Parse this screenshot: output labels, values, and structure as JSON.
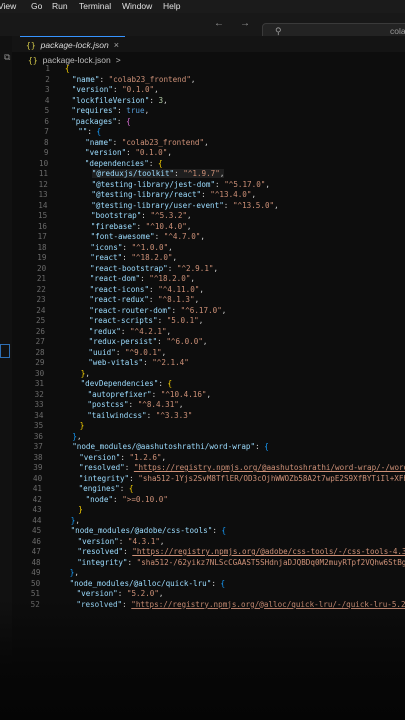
{
  "menu": [
    "View",
    "Go",
    "Run",
    "Terminal",
    "Window",
    "Help"
  ],
  "search": {
    "text": "colab"
  },
  "tab": {
    "braces": "{}",
    "label": "package-lock.json",
    "close": "×"
  },
  "breadcrumb": {
    "braces": "{}",
    "label": "package-lock.json",
    "chevron": ">"
  },
  "nav": {
    "back": "←",
    "forward": "→"
  },
  "lines": [
    {
      "n": 1,
      "i": 0,
      "t": [
        [
          "br1",
          "{"
        ]
      ]
    },
    {
      "n": 2,
      "i": 1,
      "t": [
        [
          "k",
          "\"name\""
        ],
        [
          "p",
          ": "
        ],
        [
          "s",
          "\"colab23_frontend\""
        ],
        [
          "p",
          ","
        ]
      ]
    },
    {
      "n": 3,
      "i": 1,
      "t": [
        [
          "k",
          "\"version\""
        ],
        [
          "p",
          ": "
        ],
        [
          "s",
          "\"0.1.0\""
        ],
        [
          "p",
          ","
        ]
      ]
    },
    {
      "n": 4,
      "i": 1,
      "t": [
        [
          "k",
          "\"lockfileVersion\""
        ],
        [
          "p",
          ": "
        ],
        [
          "n",
          "3"
        ],
        [
          "p",
          ","
        ]
      ]
    },
    {
      "n": 5,
      "i": 1,
      "t": [
        [
          "k",
          "\"requires\""
        ],
        [
          "p",
          ": "
        ],
        [
          "b",
          "true"
        ],
        [
          "p",
          ","
        ]
      ]
    },
    {
      "n": 6,
      "i": 1,
      "t": [
        [
          "k",
          "\"packages\""
        ],
        [
          "p",
          ": "
        ],
        [
          "br2",
          "{"
        ]
      ]
    },
    {
      "n": 7,
      "i": 2,
      "t": [
        [
          "k",
          "\"\""
        ],
        [
          "p",
          ": "
        ],
        [
          "br3",
          "{"
        ]
      ]
    },
    {
      "n": 8,
      "i": 3,
      "t": [
        [
          "k",
          "\"name\""
        ],
        [
          "p",
          ": "
        ],
        [
          "s",
          "\"colab23_frontend\""
        ],
        [
          "p",
          ","
        ]
      ]
    },
    {
      "n": 9,
      "i": 3,
      "t": [
        [
          "k",
          "\"version\""
        ],
        [
          "p",
          ": "
        ],
        [
          "s",
          "\"0.1.0\""
        ],
        [
          "p",
          ","
        ]
      ]
    },
    {
      "n": 10,
      "i": 3,
      "t": [
        [
          "k",
          "\"dependencies\""
        ],
        [
          "p",
          ": "
        ],
        [
          "br1",
          "{"
        ]
      ]
    },
    {
      "n": 11,
      "i": 4,
      "t": [
        [
          "k",
          "\"@reduxjs/toolkit\""
        ],
        [
          "p",
          ": "
        ],
        [
          "s",
          "\"^1.9.7\""
        ],
        [
          "p",
          ","
        ]
      ],
      "hl": true
    },
    {
      "n": 12,
      "i": 4,
      "t": [
        [
          "k",
          "\"@testing-library/jest-dom\""
        ],
        [
          "p",
          ": "
        ],
        [
          "s",
          "\"^5.17.0\""
        ],
        [
          "p",
          ","
        ]
      ]
    },
    {
      "n": 13,
      "i": 4,
      "t": [
        [
          "k",
          "\"@testing-library/react\""
        ],
        [
          "p",
          ": "
        ],
        [
          "s",
          "\"^13.4.0\""
        ],
        [
          "p",
          ","
        ]
      ]
    },
    {
      "n": 14,
      "i": 4,
      "t": [
        [
          "k",
          "\"@testing-library/user-event\""
        ],
        [
          "p",
          ": "
        ],
        [
          "s",
          "\"^13.5.0\""
        ],
        [
          "p",
          ","
        ]
      ]
    },
    {
      "n": 15,
      "i": 4,
      "t": [
        [
          "k",
          "\"bootstrap\""
        ],
        [
          "p",
          ": "
        ],
        [
          "s",
          "\"^5.3.2\""
        ],
        [
          "p",
          ","
        ]
      ]
    },
    {
      "n": 16,
      "i": 4,
      "t": [
        [
          "k",
          "\"firebase\""
        ],
        [
          "p",
          ": "
        ],
        [
          "s",
          "\"^10.4.0\""
        ],
        [
          "p",
          ","
        ]
      ]
    },
    {
      "n": 17,
      "i": 4,
      "t": [
        [
          "k",
          "\"font-awesome\""
        ],
        [
          "p",
          ": "
        ],
        [
          "s",
          "\"^4.7.0\""
        ],
        [
          "p",
          ","
        ]
      ]
    },
    {
      "n": 18,
      "i": 4,
      "t": [
        [
          "k",
          "\"icons\""
        ],
        [
          "p",
          ": "
        ],
        [
          "s",
          "\"^1.0.0\""
        ],
        [
          "p",
          ","
        ]
      ]
    },
    {
      "n": 19,
      "i": 4,
      "t": [
        [
          "k",
          "\"react\""
        ],
        [
          "p",
          ": "
        ],
        [
          "s",
          "\"^18.2.0\""
        ],
        [
          "p",
          ","
        ]
      ]
    },
    {
      "n": 20,
      "i": 4,
      "t": [
        [
          "k",
          "\"react-bootstrap\""
        ],
        [
          "p",
          ": "
        ],
        [
          "s",
          "\"^2.9.1\""
        ],
        [
          "p",
          ","
        ]
      ]
    },
    {
      "n": 21,
      "i": 4,
      "t": [
        [
          "k",
          "\"react-dom\""
        ],
        [
          "p",
          ": "
        ],
        [
          "s",
          "\"^18.2.0\""
        ],
        [
          "p",
          ","
        ]
      ]
    },
    {
      "n": 22,
      "i": 4,
      "t": [
        [
          "k",
          "\"react-icons\""
        ],
        [
          "p",
          ": "
        ],
        [
          "s",
          "\"^4.11.0\""
        ],
        [
          "p",
          ","
        ]
      ]
    },
    {
      "n": 23,
      "i": 4,
      "t": [
        [
          "k",
          "\"react-redux\""
        ],
        [
          "p",
          ": "
        ],
        [
          "s",
          "\"^8.1.3\""
        ],
        [
          "p",
          ","
        ]
      ]
    },
    {
      "n": 24,
      "i": 4,
      "t": [
        [
          "k",
          "\"react-router-dom\""
        ],
        [
          "p",
          ": "
        ],
        [
          "s",
          "\"^6.17.0\""
        ],
        [
          "p",
          ","
        ]
      ]
    },
    {
      "n": 25,
      "i": 4,
      "t": [
        [
          "k",
          "\"react-scripts\""
        ],
        [
          "p",
          ": "
        ],
        [
          "s",
          "\"5.0.1\""
        ],
        [
          "p",
          ","
        ]
      ]
    },
    {
      "n": 26,
      "i": 4,
      "t": [
        [
          "k",
          "\"redux\""
        ],
        [
          "p",
          ": "
        ],
        [
          "s",
          "\"^4.2.1\""
        ],
        [
          "p",
          ","
        ]
      ]
    },
    {
      "n": 27,
      "i": 4,
      "t": [
        [
          "k",
          "\"redux-persist\""
        ],
        [
          "p",
          ": "
        ],
        [
          "s",
          "\"^6.0.0\""
        ],
        [
          "p",
          ","
        ]
      ]
    },
    {
      "n": 28,
      "i": 4,
      "t": [
        [
          "k",
          "\"uuid\""
        ],
        [
          "p",
          ": "
        ],
        [
          "s",
          "\"^9.0.1\""
        ],
        [
          "p",
          ","
        ]
      ]
    },
    {
      "n": 29,
      "i": 4,
      "t": [
        [
          "k",
          "\"web-vitals\""
        ],
        [
          "p",
          ": "
        ],
        [
          "s",
          "\"^2.1.4\""
        ]
      ]
    },
    {
      "n": 30,
      "i": 3,
      "t": [
        [
          "br1",
          "}"
        ],
        [
          "p",
          ","
        ]
      ]
    },
    {
      "n": 31,
      "i": 3,
      "t": [
        [
          "k",
          "\"devDependencies\""
        ],
        [
          "p",
          ": "
        ],
        [
          "br1",
          "{"
        ]
      ]
    },
    {
      "n": 32,
      "i": 4,
      "t": [
        [
          "k",
          "\"autoprefixer\""
        ],
        [
          "p",
          ": "
        ],
        [
          "s",
          "\"^10.4.16\""
        ],
        [
          "p",
          ","
        ]
      ]
    },
    {
      "n": 33,
      "i": 4,
      "t": [
        [
          "k",
          "\"postcss\""
        ],
        [
          "p",
          ": "
        ],
        [
          "s",
          "\"^8.4.31\""
        ],
        [
          "p",
          ","
        ]
      ]
    },
    {
      "n": 34,
      "i": 4,
      "t": [
        [
          "k",
          "\"tailwindcss\""
        ],
        [
          "p",
          ": "
        ],
        [
          "s",
          "\"^3.3.3\""
        ]
      ]
    },
    {
      "n": 35,
      "i": 3,
      "t": [
        [
          "br1",
          "}"
        ]
      ]
    },
    {
      "n": 36,
      "i": 2,
      "t": [
        [
          "br3",
          "}"
        ],
        [
          "p",
          ","
        ]
      ]
    },
    {
      "n": 37,
      "i": 2,
      "t": [
        [
          "k",
          "\"node_modules/@aashutoshrathi/word-wrap\""
        ],
        [
          "p",
          ": "
        ],
        [
          "br3",
          "{"
        ]
      ]
    },
    {
      "n": 38,
      "i": 3,
      "t": [
        [
          "k",
          "\"version\""
        ],
        [
          "p",
          ": "
        ],
        [
          "s",
          "\"1.2.6\""
        ],
        [
          "p",
          ","
        ]
      ]
    },
    {
      "n": 39,
      "i": 3,
      "t": [
        [
          "k",
          "\"resolved\""
        ],
        [
          "p",
          ": "
        ],
        [
          "u",
          "\"https://registry.npmjs.org/@aashutoshrathi/word-wrap/-/word-"
        ]
      ]
    },
    {
      "n": 40,
      "i": 3,
      "t": [
        [
          "k",
          "\"integrity\""
        ],
        [
          "p",
          ": "
        ],
        [
          "s",
          "\"sha512-1Yjs2SvM8TflER/OD3cOjhWWOZb58A2t7wpE2S9XfBYTiIl+XFhQ"
        ]
      ]
    },
    {
      "n": 41,
      "i": 3,
      "t": [
        [
          "k",
          "\"engines\""
        ],
        [
          "p",
          ": "
        ],
        [
          "br1",
          "{"
        ]
      ]
    },
    {
      "n": 42,
      "i": 4,
      "t": [
        [
          "k",
          "\"node\""
        ],
        [
          "p",
          ": "
        ],
        [
          "s",
          "\">=0.10.0\""
        ]
      ]
    },
    {
      "n": 43,
      "i": 3,
      "t": [
        [
          "br1",
          "}"
        ]
      ]
    },
    {
      "n": 44,
      "i": 2,
      "t": [
        [
          "br3",
          "}"
        ],
        [
          "p",
          ","
        ]
      ]
    },
    {
      "n": 45,
      "i": 2,
      "t": [
        [
          "k",
          "\"node_modules/@adobe/css-tools\""
        ],
        [
          "p",
          ": "
        ],
        [
          "br3",
          "{"
        ]
      ]
    },
    {
      "n": 46,
      "i": 3,
      "t": [
        [
          "k",
          "\"version\""
        ],
        [
          "p",
          ": "
        ],
        [
          "s",
          "\"4.3.1\""
        ],
        [
          "p",
          ","
        ]
      ]
    },
    {
      "n": 47,
      "i": 3,
      "t": [
        [
          "k",
          "\"resolved\""
        ],
        [
          "p",
          ": "
        ],
        [
          "u",
          "\"https://registry.npmjs.org/@adobe/css-tools/-/css-tools-4.3."
        ]
      ]
    },
    {
      "n": 48,
      "i": 3,
      "t": [
        [
          "k",
          "\"integrity\""
        ],
        [
          "p",
          ": "
        ],
        [
          "s",
          "\"sha512-/62yikz7NLScCGAAST5SHdnjaDJQBDq0M2muyRTpf2VQhw6StBg2"
        ]
      ]
    },
    {
      "n": 49,
      "i": 2,
      "t": [
        [
          "br3",
          "}"
        ],
        [
          "p",
          ","
        ]
      ]
    },
    {
      "n": 50,
      "i": 2,
      "t": [
        [
          "k",
          "\"node_modules/@alloc/quick-lru\""
        ],
        [
          "p",
          ": "
        ],
        [
          "br3",
          "{"
        ]
      ]
    },
    {
      "n": 51,
      "i": 3,
      "t": [
        [
          "k",
          "\"version\""
        ],
        [
          "p",
          ": "
        ],
        [
          "s",
          "\"5.2.0\""
        ],
        [
          "p",
          ","
        ]
      ]
    },
    {
      "n": 52,
      "i": 3,
      "t": [
        [
          "k",
          "\"resolved\""
        ],
        [
          "p",
          ": "
        ],
        [
          "u",
          "\"https://registry.npmjs.org/@alloc/quick-lru/-/quick-lru-5.2.0"
        ]
      ]
    }
  ]
}
